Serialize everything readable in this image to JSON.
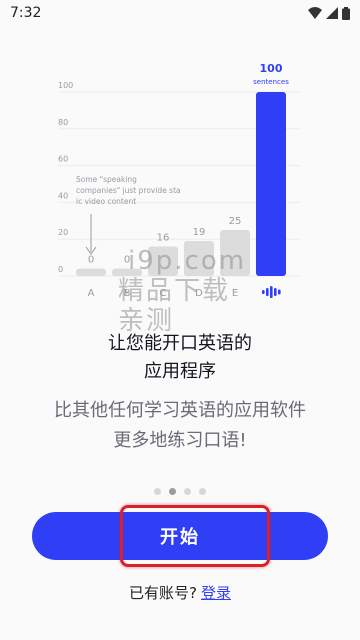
{
  "status_bar": {
    "time": "7:32"
  },
  "chart_data": {
    "type": "bar",
    "categories": [
      "A",
      "B",
      "C",
      "D",
      "E",
      ""
    ],
    "values": [
      0,
      0,
      16,
      19,
      25,
      100
    ],
    "ylim": [
      0,
      100
    ],
    "yticks": [
      0,
      20,
      40,
      60,
      80,
      100
    ],
    "highlight_label": "100",
    "highlight_unit": "sentences",
    "annotation": "Some \"speaking companies\" just provide static video content",
    "colors": {
      "bar": "#dcdcdc",
      "highlight": "#2f3ff5",
      "text": "#9a9aa3"
    }
  },
  "watermark": {
    "line1": "i9p.com",
    "line2": "精品下载",
    "line3": "亲测"
  },
  "headline": {
    "line1": "让您能开口英语的",
    "line2": "应用程序"
  },
  "subtitle": {
    "line1": "比其他任何学习英语的应用软件",
    "line2": "更多地练习口语!"
  },
  "pager": {
    "count": 4,
    "active": 1
  },
  "start_button": {
    "label": "开始",
    "color": "#2f3ff5"
  },
  "login": {
    "prompt": "已有账号?",
    "link": "登录"
  }
}
